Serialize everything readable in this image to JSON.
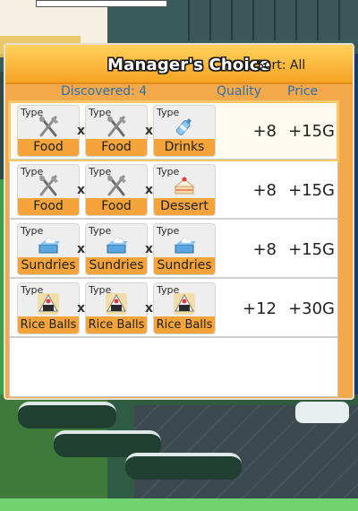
{
  "panel": {
    "title": "Manager's Choice",
    "sort_label": "Sort: All",
    "discovered_label": "Discovered: 4",
    "quality_header": "Quality",
    "price_header": "Price"
  },
  "rows": [
    {
      "selected": true,
      "items": [
        {
          "type_label": "Type",
          "category": "Food",
          "icon": "fork-knife-icon"
        },
        {
          "type_label": "Type",
          "category": "Food",
          "icon": "fork-knife-icon"
        },
        {
          "type_label": "Type",
          "category": "Drinks",
          "icon": "bottle-icon"
        }
      ],
      "sep": "x",
      "quality": "+8",
      "price": "+15G"
    },
    {
      "selected": false,
      "items": [
        {
          "type_label": "Type",
          "category": "Food",
          "icon": "fork-knife-icon"
        },
        {
          "type_label": "Type",
          "category": "Food",
          "icon": "fork-knife-icon"
        },
        {
          "type_label": "Type",
          "category": "Dessert",
          "icon": "cake-icon"
        }
      ],
      "sep": "x",
      "quality": "+8",
      "price": "+15G"
    },
    {
      "selected": false,
      "items": [
        {
          "type_label": "Type",
          "category": "Sundries",
          "icon": "tissue-box-icon"
        },
        {
          "type_label": "Type",
          "category": "Sundries",
          "icon": "tissue-box-icon"
        },
        {
          "type_label": "Type",
          "category": "Sundries",
          "icon": "tissue-box-icon"
        }
      ],
      "sep": "x",
      "quality": "+8",
      "price": "+15G"
    },
    {
      "selected": false,
      "items": [
        {
          "type_label": "Type",
          "category": "Rice Balls",
          "icon": "rice-ball-icon"
        },
        {
          "type_label": "Type",
          "category": "Rice Balls",
          "icon": "rice-ball-icon"
        },
        {
          "type_label": "Type",
          "category": "Rice Balls",
          "icon": "rice-ball-icon"
        }
      ],
      "sep": "x",
      "quality": "+12",
      "price": "+30G"
    }
  ],
  "colors": {
    "header_orange": "#f6a323",
    "category_orange": "#f4a43a",
    "column_header_blue": "#2d6fb0",
    "selected_outline": "#f7c86a"
  }
}
